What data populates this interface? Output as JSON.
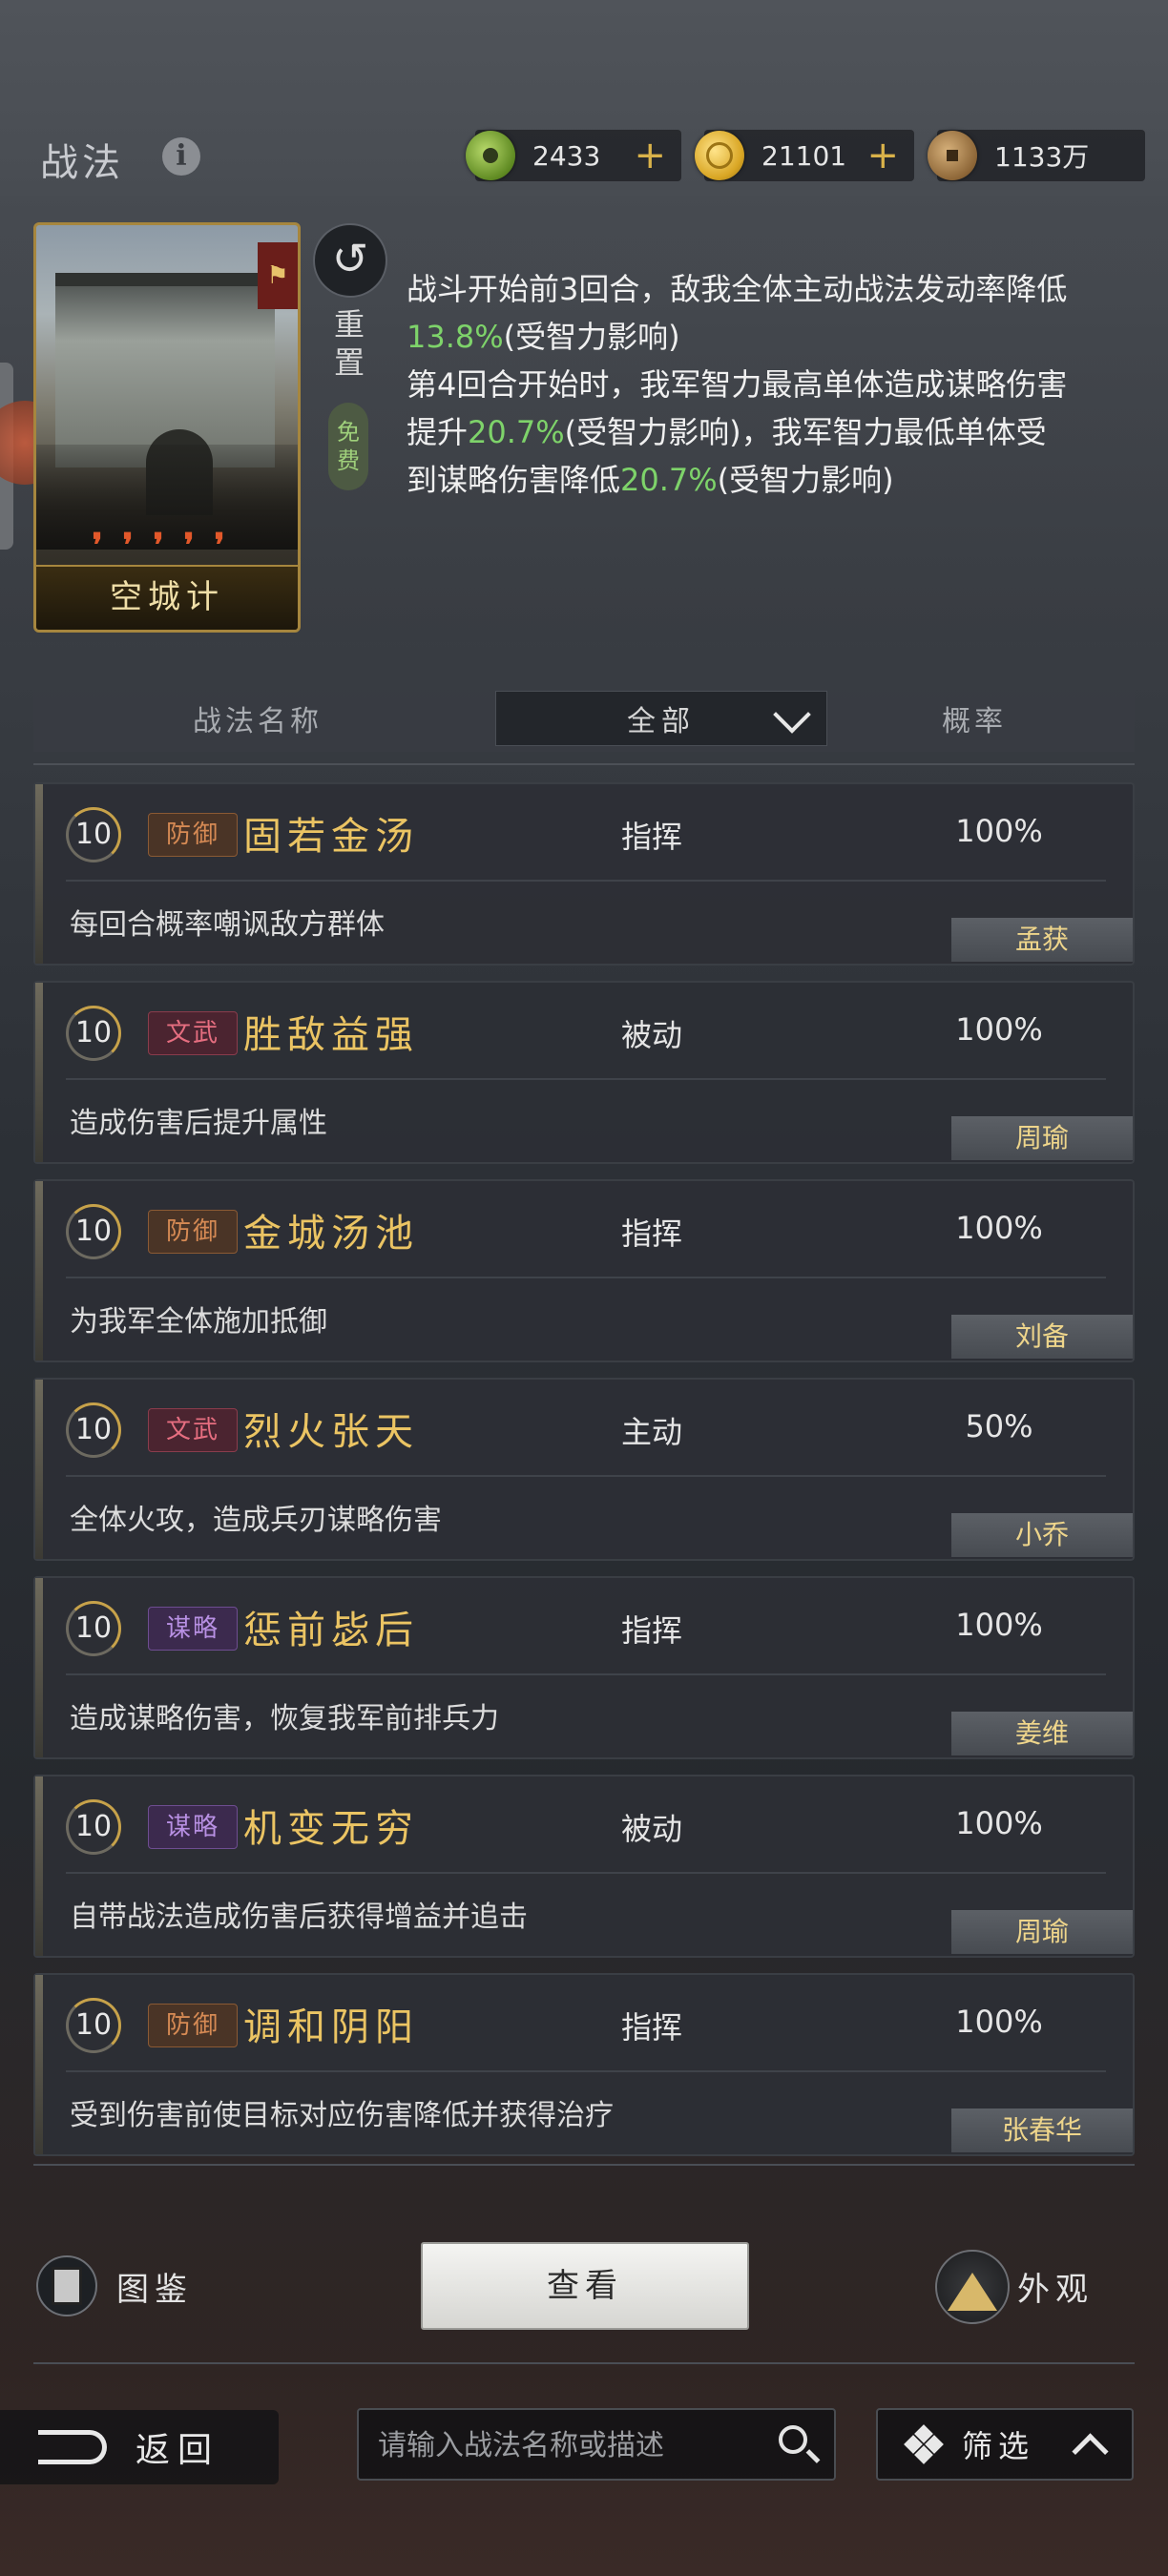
{
  "page": {
    "title": "战法"
  },
  "currency": [
    {
      "icon": "jade-coin-icon",
      "value": "2433",
      "plus": "+"
    },
    {
      "icon": "gold-coin-icon",
      "value": "21101",
      "plus": "+"
    },
    {
      "icon": "copper-coin-icon",
      "value": "1133万"
    }
  ],
  "selected": {
    "card_name": "空城计",
    "reset_label": "重置",
    "free_label": "免费",
    "desc_parts": [
      "战斗开始前3回合，敌我全体主动战法发动率降低",
      "13.8%",
      "(受智力影响)",
      "第4回合开始时，我军智力最高单体造成谋略伤害提升",
      "20.7%",
      "(受智力影响)，我军智力最低单体受到谋略伤害降低",
      "20.7%",
      "(受智力影响)"
    ]
  },
  "columns": {
    "name": "战法名称",
    "filter": "全部",
    "rate": "概率"
  },
  "skills": [
    {
      "level": "10",
      "tag": "防御",
      "tag_type": "def",
      "name": "固若金汤",
      "type": "指挥",
      "rate": "100%",
      "desc": "每回合概率嘲讽敌方群体",
      "owner": "孟获"
    },
    {
      "level": "10",
      "tag": "文武",
      "tag_type": "wen",
      "name": "胜敌益强",
      "type": "被动",
      "rate": "100%",
      "desc": "造成伤害后提升属性",
      "owner": "周瑜"
    },
    {
      "level": "10",
      "tag": "防御",
      "tag_type": "def",
      "name": "金城汤池",
      "type": "指挥",
      "rate": "100%",
      "desc": "为我军全体施加抵御",
      "owner": "刘备"
    },
    {
      "level": "10",
      "tag": "文武",
      "tag_type": "wen",
      "name": "烈火张天",
      "type": "主动",
      "rate": "50%",
      "desc": "全体火攻，造成兵刃谋略伤害",
      "owner": "小乔"
    },
    {
      "level": "10",
      "tag": "谋略",
      "tag_type": "mou",
      "name": "惩前毖后",
      "type": "指挥",
      "rate": "100%",
      "desc": "造成谋略伤害，恢复我军前排兵力",
      "owner": "姜维"
    },
    {
      "level": "10",
      "tag": "谋略",
      "tag_type": "mou",
      "name": "机变无穷",
      "type": "被动",
      "rate": "100%",
      "desc": "自带战法造成伤害后获得增益并追击",
      "owner": "周瑜"
    },
    {
      "level": "10",
      "tag": "防御",
      "tag_type": "def",
      "name": "调和阴阳",
      "type": "指挥",
      "rate": "100%",
      "desc": "受到伤害前使目标对应伤害降低并获得治疗",
      "owner": "张春华"
    }
  ],
  "bottom": {
    "gallery_label": "图鉴",
    "view_label": "查看",
    "skin_label": "外观",
    "back_label": "返回",
    "search_placeholder": "请输入战法名称或描述",
    "filter_label": "筛选"
  }
}
